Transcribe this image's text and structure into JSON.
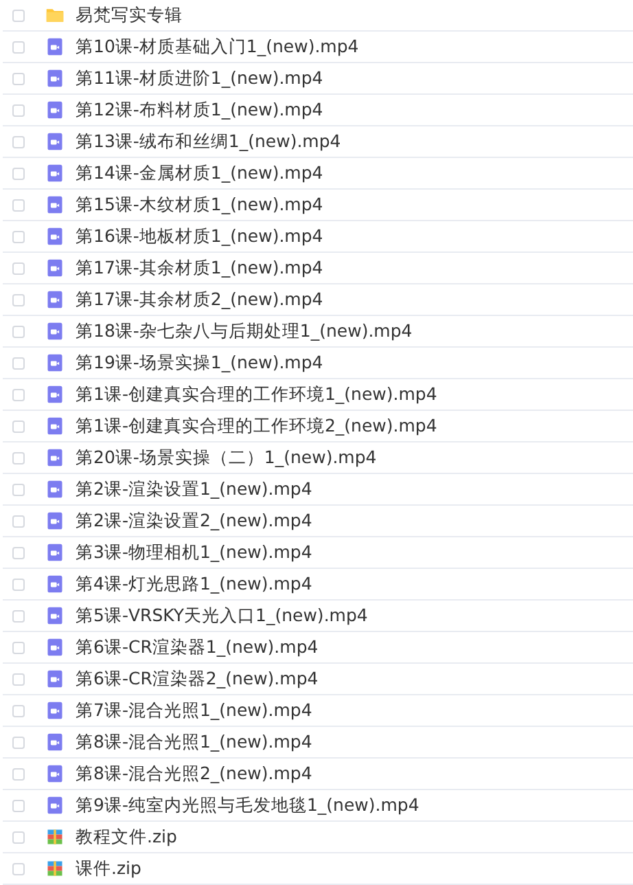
{
  "files": [
    {
      "kind": "folder",
      "name": "易梵写实专辑",
      "checked": false
    },
    {
      "kind": "video",
      "name": "第10课-材质基础入门1_(new).mp4",
      "checked": false
    },
    {
      "kind": "video",
      "name": "第11课-材质进阶1_(new).mp4",
      "checked": false
    },
    {
      "kind": "video",
      "name": "第12课-布料材质1_(new).mp4",
      "checked": false
    },
    {
      "kind": "video",
      "name": "第13课-绒布和丝绸1_(new).mp4",
      "checked": false
    },
    {
      "kind": "video",
      "name": "第14课-金属材质1_(new).mp4",
      "checked": false
    },
    {
      "kind": "video",
      "name": "第15课-木纹材质1_(new).mp4",
      "checked": false
    },
    {
      "kind": "video",
      "name": "第16课-地板材质1_(new).mp4",
      "checked": false
    },
    {
      "kind": "video",
      "name": "第17课-其余材质1_(new).mp4",
      "checked": false
    },
    {
      "kind": "video",
      "name": "第17课-其余材质2_(new).mp4",
      "checked": false
    },
    {
      "kind": "video",
      "name": "第18课-杂七杂八与后期处理1_(new).mp4",
      "checked": false
    },
    {
      "kind": "video",
      "name": "第19课-场景实操1_(new).mp4",
      "checked": false
    },
    {
      "kind": "video",
      "name": "第1课-创建真实合理的工作环境1_(new).mp4",
      "checked": false
    },
    {
      "kind": "video",
      "name": "第1课-创建真实合理的工作环境2_(new).mp4",
      "checked": false
    },
    {
      "kind": "video",
      "name": "第20课-场景实操（二）1_(new).mp4",
      "checked": false
    },
    {
      "kind": "video",
      "name": "第2课-渲染设置1_(new).mp4",
      "checked": false
    },
    {
      "kind": "video",
      "name": "第2课-渲染设置2_(new).mp4",
      "checked": false
    },
    {
      "kind": "video",
      "name": "第3课-物理相机1_(new).mp4",
      "checked": false
    },
    {
      "kind": "video",
      "name": "第4课-灯光思路1_(new).mp4",
      "checked": false
    },
    {
      "kind": "video",
      "name": "第5课-VRSKY天光入口1_(new).mp4",
      "checked": false
    },
    {
      "kind": "video",
      "name": "第6课-CR渲染器1_(new).mp4",
      "checked": false
    },
    {
      "kind": "video",
      "name": "第6课-CR渲染器2_(new).mp4",
      "checked": false
    },
    {
      "kind": "video",
      "name": "第7课-混合光照1_(new).mp4",
      "checked": false
    },
    {
      "kind": "video",
      "name": "第8课-混合光照1_(new).mp4",
      "checked": false
    },
    {
      "kind": "video",
      "name": "第8课-混合光照2_(new).mp4",
      "checked": false
    },
    {
      "kind": "video",
      "name": "第9课-纯室内光照与毛发地毯1_(new).mp4",
      "checked": false
    },
    {
      "kind": "archive",
      "name": "教程文件.zip",
      "checked": false
    },
    {
      "kind": "archive",
      "name": "课件.zip",
      "checked": false
    }
  ]
}
